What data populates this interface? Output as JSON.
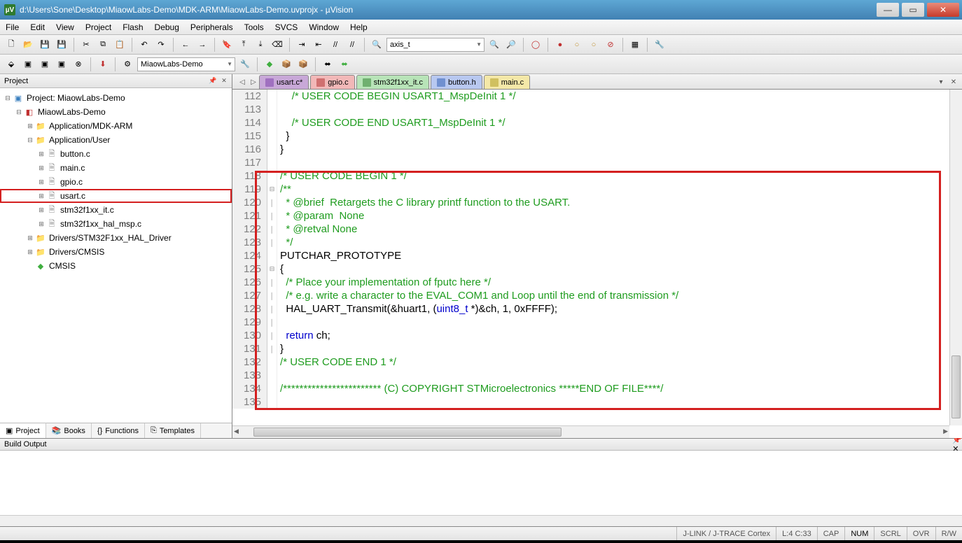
{
  "title": "d:\\Users\\Sone\\Desktop\\MiaowLabs-Demo\\MDK-ARM\\MiaowLabs-Demo.uvprojx - µVision",
  "menu": [
    "File",
    "Edit",
    "View",
    "Project",
    "Flash",
    "Debug",
    "Peripherals",
    "Tools",
    "SVCS",
    "Window",
    "Help"
  ],
  "combo_find": "axis_t",
  "combo_target": "MiaowLabs-Demo",
  "project_panel_title": "Project",
  "tree": {
    "root": "Project: MiaowLabs-Demo",
    "target": "MiaowLabs-Demo",
    "groups": [
      {
        "name": "Application/MDK-ARM",
        "files": []
      },
      {
        "name": "Application/User",
        "files": [
          "button.c",
          "main.c",
          "gpio.c",
          "usart.c",
          "stm32f1xx_it.c",
          "stm32f1xx_hal_msp.c"
        ],
        "selected": "usart.c"
      },
      {
        "name": "Drivers/STM32F1xx_HAL_Driver",
        "files": []
      },
      {
        "name": "Drivers/CMSIS",
        "files": []
      },
      {
        "name": "CMSIS",
        "icon": "diamond",
        "files": []
      }
    ]
  },
  "side_tabs": [
    "Project",
    "Books",
    "Functions",
    "Templates"
  ],
  "file_tabs": [
    {
      "label": "usart.c*",
      "cls": "active"
    },
    {
      "label": "gpio.c",
      "cls": "red"
    },
    {
      "label": "stm32f1xx_it.c",
      "cls": "green"
    },
    {
      "label": "button.h",
      "cls": "blue"
    },
    {
      "label": "main.c",
      "cls": "yellow"
    }
  ],
  "code_start_line": 112,
  "code_lines": [
    {
      "t": "    /* USER CODE BEGIN USART1_MspDeInit 1 */",
      "c": "cmt"
    },
    {
      "t": "",
      "c": "txt"
    },
    {
      "t": "    /* USER CODE END USART1_MspDeInit 1 */",
      "c": "cmt"
    },
    {
      "t": "  }",
      "c": "txt"
    },
    {
      "t": "}",
      "c": "txt"
    },
    {
      "t": "",
      "c": "txt"
    },
    {
      "t": "/* USER CODE BEGIN 1 */",
      "c": "cmt"
    },
    {
      "t": "/**",
      "c": "cmt",
      "fold": "-"
    },
    {
      "t": "  * @brief  Retargets the C library printf function to the USART.",
      "c": "cmt",
      "bar": true
    },
    {
      "t": "  * @param  None",
      "c": "cmt",
      "bar": true
    },
    {
      "t": "  * @retval None",
      "c": "cmt",
      "bar": true
    },
    {
      "t": "  */",
      "c": "cmt",
      "bar": true
    },
    {
      "t": "PUTCHAR_PROTOTYPE",
      "c": "txt"
    },
    {
      "t": "{",
      "c": "txt",
      "fold": "-"
    },
    {
      "t": "  /* Place your implementation of fputc here */",
      "c": "cmt",
      "bar": true
    },
    {
      "t": "  /* e.g. write a character to the EVAL_COM1 and Loop until the end of transmission */",
      "c": "cmt",
      "bar": true
    },
    {
      "raw": "  <span class='txt'>HAL_UART_Transmit(&amp;huart1, (</span><span class='kw'>uint8_t</span><span class='txt'> *)&amp;ch, </span><span class='num'>1</span><span class='txt'>, </span><span class='num'>0xFFFF</span><span class='txt'>);</span>",
      "bar": true
    },
    {
      "t": "",
      "c": "txt",
      "bar": true
    },
    {
      "raw": "  <span class='kw'>return</span><span class='txt'> ch;</span>",
      "bar": true
    },
    {
      "t": "}",
      "c": "txt",
      "bar": true
    },
    {
      "t": "/* USER CODE END 1 */",
      "c": "cmt"
    },
    {
      "t": "",
      "c": "txt"
    },
    {
      "t": "/************************ (C) COPYRIGHT STMicroelectronics *****END OF FILE****/",
      "c": "cmt"
    },
    {
      "t": "",
      "c": "txt"
    }
  ],
  "build_panel_title": "Build Output",
  "status": {
    "debugger": "J-LINK / J-TRACE Cortex",
    "pos": "L:4 C:33",
    "flags": [
      "CAP",
      "NUM",
      "SCRL",
      "OVR",
      "R/W"
    ]
  }
}
